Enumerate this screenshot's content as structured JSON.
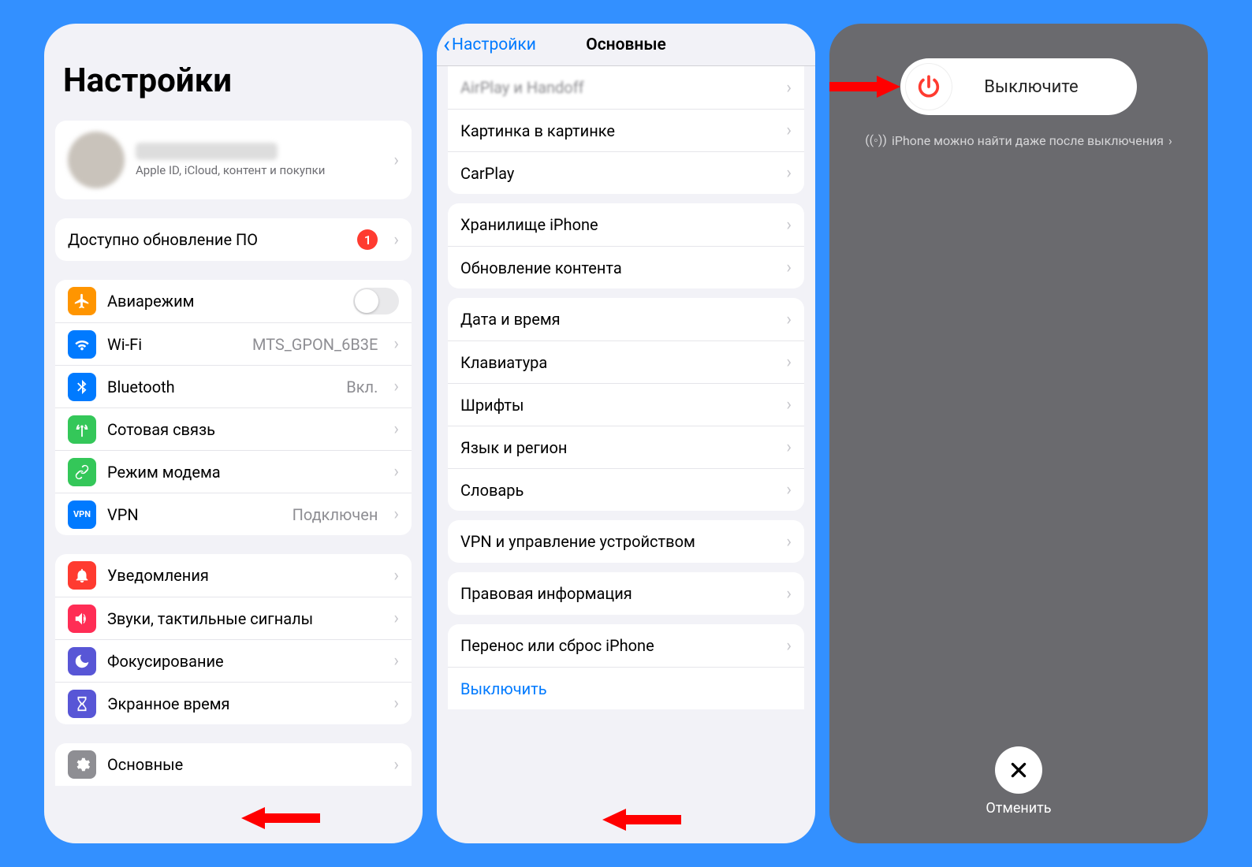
{
  "panel1": {
    "title": "Настройки",
    "apple_sub": "Apple ID, iCloud, контент и покупки",
    "update_row": {
      "label": "Доступно обновление ПО",
      "badge": "1"
    },
    "net": {
      "airplane": "Авиарежим",
      "wifi": "Wi-Fi",
      "wifi_val": "MTS_GPON_6B3E",
      "bt": "Bluetooth",
      "bt_val": "Вкл.",
      "cell": "Сотовая связь",
      "hotspot": "Режим модема",
      "vpn": "VPN",
      "vpn_val": "Подключен"
    },
    "alerts": {
      "notif": "Уведомления",
      "sounds": "Звуки, тактильные сигналы",
      "focus": "Фокусирование",
      "screentime": "Экранное время"
    },
    "general": "Основные"
  },
  "panel2": {
    "back": "Настройки",
    "title": "Основные",
    "rows": {
      "cut_top": "AirPlay и Handoff",
      "pip": "Картинка в картинке",
      "carplay": "CarPlay",
      "storage": "Хранилище iPhone",
      "content_refresh": "Обновление контента",
      "datetime": "Дата и время",
      "keyboard": "Клавиатура",
      "fonts": "Шрифты",
      "lang": "Язык и регион",
      "dict": "Словарь",
      "vpn_mgmt": "VPN и управление устройством",
      "legal": "Правовая информация",
      "reset": "Перенос или сброс iPhone",
      "shutdown": "Выключить"
    }
  },
  "panel3": {
    "slide_label": "Выключите",
    "findmy": "iPhone можно найти даже после выключения",
    "cancel": "Отменить"
  }
}
